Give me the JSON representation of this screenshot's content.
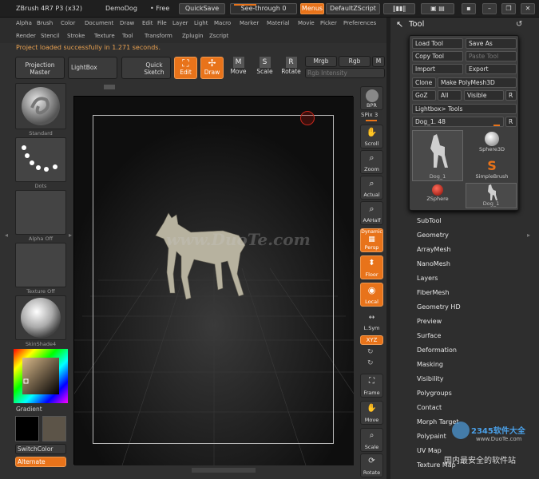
{
  "titlebar": {
    "app": "ZBrush 4R7 P3 (x32)",
    "document": "DemoDog",
    "free": "• Free",
    "quicksave": "QuickSave",
    "seethrough": "See-through 0",
    "menus": "Menus",
    "script": "DefaultZScript"
  },
  "menu": [
    "Alpha",
    "Brush",
    "Color",
    "Document",
    "Draw",
    "Edit",
    "File",
    "Layer",
    "Light",
    "Macro",
    "Marker",
    "Material",
    "Movie",
    "Picker",
    "Preferences"
  ],
  "menu2": [
    "Render",
    "Stencil",
    "Stroke",
    "Texture",
    "Tool",
    "Transform",
    "Zplugin",
    "Zscript"
  ],
  "notice": "Project loaded successfully in 1.271 seconds.",
  "toolbar": {
    "projection": "Projection\nMaster",
    "lightbox": "LightBox",
    "quicksketch": "Quick\nSketch",
    "edit": "Edit",
    "draw": "Draw",
    "move": "Move",
    "scale": "Scale",
    "rotate": "Rotate",
    "mrgb": "Mrgb",
    "rgb": "Rgb",
    "m": "M",
    "rgb_intensity": "Rgb Intensity"
  },
  "shelf": {
    "standard": "Standard",
    "dots": "Dots",
    "alpha": "Alpha Off",
    "texture": "Texture Off",
    "material": "SkinShade4",
    "gradient": "Gradient",
    "switchcolor": "SwitchColor",
    "alternate": "Alternate"
  },
  "rshelf": [
    "BPR",
    "SPix 3",
    "Scroll",
    "Zoom",
    "Actual",
    "AAHalf",
    "Persp",
    "Floor",
    "Local",
    "L.Sym",
    "Frame",
    "Move",
    "Scale",
    "Rotate"
  ],
  "rshelf_dynamic": "Dynamic",
  "rshelf_xyz": "XYZ",
  "tool": {
    "title": "Tool",
    "load": "Load Tool",
    "saveas": "Save As",
    "copy": "Copy Tool",
    "paste": "Paste Tool",
    "import": "Import",
    "export": "Export",
    "clone": "Clone",
    "make": "Make PolyMesh3D",
    "goz": "GoZ",
    "all": "All",
    "visible": "Visible",
    "r": "R",
    "lightbox_tools": "Lightbox> Tools",
    "current": "Dog_1. 48",
    "items": [
      "Dog_1",
      "Sphere3D",
      "SimpleBrush",
      "ZSphere",
      "Dog_1"
    ]
  },
  "subpalettes": [
    "SubTool",
    "Geometry",
    "ArrayMesh",
    "NanoMesh",
    "Layers",
    "FiberMesh",
    "Geometry HD",
    "Preview",
    "Surface",
    "Deformation",
    "Masking",
    "Visibility",
    "Polygroups",
    "Contact",
    "Morph Target",
    "Polypaint",
    "UV Map",
    "Texture Map"
  ],
  "watermark": "www.DuoTe.com",
  "watermark2": "2345软件大全",
  "watermark3": "www.DuoTe.com",
  "watermark4": "国内最安全的软件站",
  "colors": {
    "accent": "#e8731a",
    "panel": "#3b3b3b",
    "canvas": "#0e0e0e"
  }
}
